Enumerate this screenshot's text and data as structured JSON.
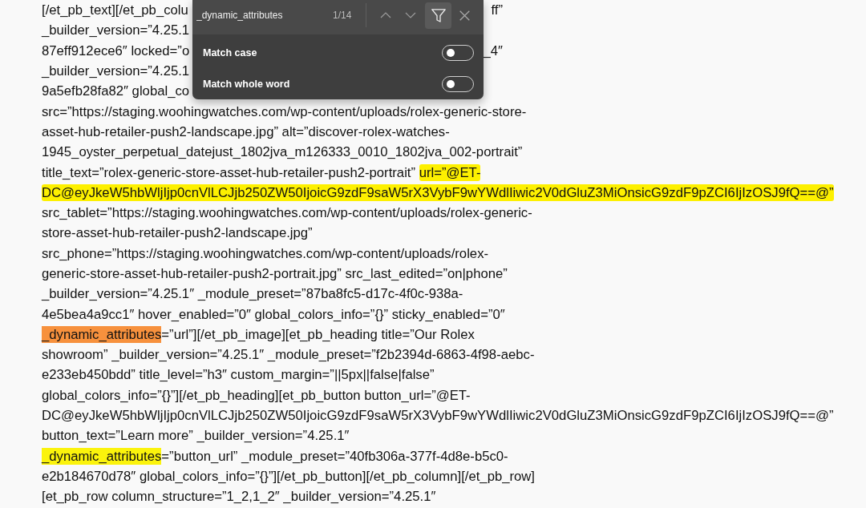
{
  "document": {
    "lines": [
      {
        "segments": [
          {
            "kind": "plain",
            "text": "[/et_pb_text][/et_pb_colu"
          }
        ],
        "trailing": "ff”"
      },
      {
        "segments": [
          {
            "kind": "plain",
            "text": "_builder_version=”4.25.1"
          }
        ]
      },
      {
        "segments": [
          {
            "kind": "plain",
            "text": "87eff912ece6″ locked=”o"
          }
        ],
        "trailing": "_4″"
      },
      {
        "segments": [
          {
            "kind": "plain",
            "text": "_builder_version=”4.25.1"
          }
        ]
      },
      {
        "segments": [
          {
            "kind": "plain",
            "text": "9a5efb28fa82″ global_co"
          }
        ]
      },
      {
        "segments": [
          {
            "kind": "plain",
            "text": "src=”https://staging.woohingwatches.com/wp-content/uploads/rolex-generic-store-"
          }
        ]
      },
      {
        "segments": [
          {
            "kind": "plain",
            "text": "asset-hub-retailer-push2-landscape.jpg” alt=”discover-rolex-watches-"
          }
        ]
      },
      {
        "segments": [
          {
            "kind": "plain",
            "text": "1945_oyster_perpetual_datejust_1802jva_m126333_0010_1802jva_002-portrait”"
          }
        ]
      },
      {
        "segments": [
          {
            "kind": "plain",
            "text": "title_text=”rolex-generic-store-asset-hub-retailer-push2-portrait” "
          },
          {
            "kind": "highlight",
            "text": "url=”@ET-"
          }
        ]
      },
      {
        "segments": [
          {
            "kind": "highlight",
            "text": "DC@eyJkeW5hbWljIjp0cnVlLCJjb250ZW50IjoicG9zdF9saW5rX3VybF9wYWdlIiwic2V0dGluZ3MiOnsicG9zdF9pZCI6IjIzOSJ9fQ==@”"
          }
        ]
      },
      {
        "segments": [
          {
            "kind": "plain",
            "text": "src_tablet=”https://staging.woohingwatches.com/wp-content/uploads/rolex-generic-"
          }
        ]
      },
      {
        "segments": [
          {
            "kind": "plain",
            "text": "store-asset-hub-retailer-push2-landscape.jpg”"
          }
        ]
      },
      {
        "segments": [
          {
            "kind": "plain",
            "text": "src_phone=”https://staging.woohingwatches.com/wp-content/uploads/rolex-"
          }
        ]
      },
      {
        "segments": [
          {
            "kind": "plain",
            "text": "generic-store-asset-hub-retailer-push2-portrait.jpg” src_last_edited=”on|phone”"
          }
        ]
      },
      {
        "segments": [
          {
            "kind": "plain",
            "text": "_builder_version=”4.25.1″ _module_preset=”87ba8fc5-d17c-4f0c-938a-"
          }
        ]
      },
      {
        "segments": [
          {
            "kind": "plain",
            "text": "4e5bea4a9cc1″ hover_enabled=”0″ global_colors_info=”{}” sticky_enabled=”0″"
          }
        ]
      },
      {
        "segments": [
          {
            "kind": "current_match",
            "text": "_dynamic_attributes"
          },
          {
            "kind": "plain",
            "text": "=”url”][/et_pb_image][et_pb_heading title=”Our Rolex"
          }
        ]
      },
      {
        "segments": [
          {
            "kind": "plain",
            "text": "showroom” _builder_version=”4.25.1″ _module_preset=”f2b2394d-6863-4f98-aebc-"
          }
        ]
      },
      {
        "segments": [
          {
            "kind": "plain",
            "text": "e233eb450bdd” title_level=”h3″ custom_margin=”||5px||false|false”"
          }
        ]
      },
      {
        "segments": [
          {
            "kind": "plain",
            "text": "global_colors_info=”{}”][/et_pb_heading][et_pb_button button_url=”@ET-"
          }
        ]
      },
      {
        "segments": [
          {
            "kind": "plain",
            "text": "DC@eyJkeW5hbWljIjp0cnVlLCJjb250ZW50IjoicG9zdF9saW5rX3VybF9wYWdlIiwic2V0dGluZ3MiOnsicG9zdF9pZCI6IjIzOSJ9fQ==@”"
          }
        ]
      },
      {
        "segments": [
          {
            "kind": "plain",
            "text": "button_text=”Learn more” _builder_version=”4.25.1″"
          }
        ]
      },
      {
        "segments": [
          {
            "kind": "match",
            "text": "_dynamic_attributes"
          },
          {
            "kind": "plain",
            "text": "=”button_url” _module_preset=”40fb306a-377f-4d8e-b5c0-"
          }
        ]
      },
      {
        "segments": [
          {
            "kind": "plain",
            "text": "e2b184670d78″ global_colors_info=”{}”][/et_pb_button][/et_pb_column][/et_pb_row]"
          }
        ]
      },
      {
        "segments": [
          {
            "kind": "plain",
            "text": "[et_pb_row column_structure=”1_2,1_2″ _builder_version=”4.25.1″"
          }
        ]
      }
    ]
  },
  "find_bar": {
    "query": "_dynamic_attributes",
    "match_count": "1/14",
    "options_expanded": true,
    "options": [
      {
        "label": "Match case",
        "on": false
      },
      {
        "label": "Match whole word",
        "on": false
      }
    ]
  }
}
